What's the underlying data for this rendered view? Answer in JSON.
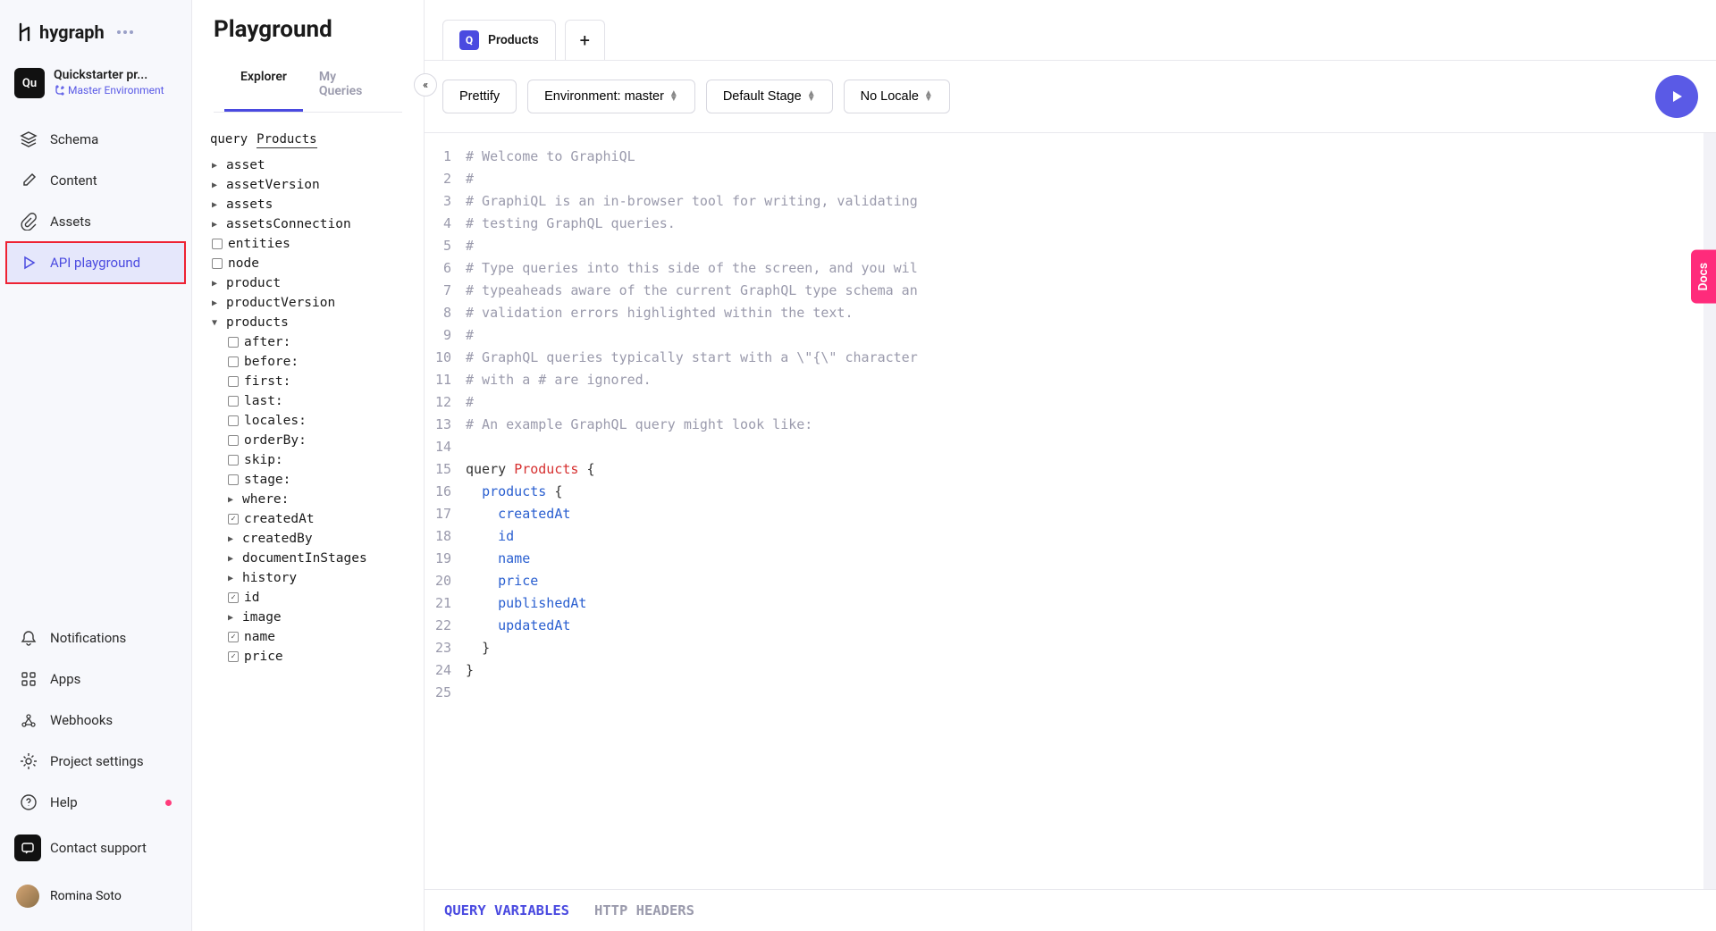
{
  "brand": {
    "name": "hygraph"
  },
  "project": {
    "badge": "Qu",
    "name": "Quickstarter pr...",
    "env_label": "Master Environment"
  },
  "sidebar": {
    "primary": [
      {
        "label": "Schema"
      },
      {
        "label": "Content"
      },
      {
        "label": "Assets"
      },
      {
        "label": "API playground"
      }
    ],
    "secondary": [
      {
        "label": "Notifications"
      },
      {
        "label": "Apps"
      },
      {
        "label": "Webhooks"
      },
      {
        "label": "Project settings"
      },
      {
        "label": "Help"
      },
      {
        "label": "Contact support"
      }
    ],
    "user": "Romina Soto"
  },
  "page": {
    "title": "Playground"
  },
  "explorer": {
    "tabs": [
      {
        "label": "Explorer"
      },
      {
        "label": "My Queries"
      }
    ],
    "query_kw": "query",
    "query_name": "Products",
    "tree": {
      "roots": [
        {
          "type": "arrow",
          "label": "asset"
        },
        {
          "type": "arrow",
          "label": "assetVersion"
        },
        {
          "type": "arrow",
          "label": "assets"
        },
        {
          "type": "arrow",
          "label": "assetsConnection"
        },
        {
          "type": "box",
          "label": "entities"
        },
        {
          "type": "box",
          "label": "node"
        },
        {
          "type": "arrow",
          "label": "product"
        },
        {
          "type": "arrow",
          "label": "productVersion"
        },
        {
          "type": "arrow-open",
          "label": "products"
        }
      ],
      "products_children": [
        {
          "type": "box",
          "label": "after:"
        },
        {
          "type": "box",
          "label": "before:"
        },
        {
          "type": "box",
          "label": "first:"
        },
        {
          "type": "box",
          "label": "last:"
        },
        {
          "type": "box",
          "label": "locales:"
        },
        {
          "type": "box",
          "label": "orderBy:"
        },
        {
          "type": "box",
          "label": "skip:"
        },
        {
          "type": "box",
          "label": "stage:"
        },
        {
          "type": "arrow",
          "label": "where:"
        },
        {
          "type": "checked",
          "label": "createdAt"
        },
        {
          "type": "arrow",
          "label": "createdBy"
        },
        {
          "type": "arrow",
          "label": "documentInStages"
        },
        {
          "type": "arrow",
          "label": "history"
        },
        {
          "type": "checked",
          "label": "id"
        },
        {
          "type": "arrow",
          "label": "image"
        },
        {
          "type": "checked",
          "label": "name"
        },
        {
          "type": "checked",
          "label": "price"
        }
      ]
    }
  },
  "queryTabs": {
    "active_label": "Products",
    "active_badge": "Q"
  },
  "toolbar": {
    "prettify": "Prettify",
    "env": "Environment: master",
    "stage": "Default Stage",
    "locale": "No Locale"
  },
  "code": {
    "lines": [
      {
        "n": 1,
        "t": "comment",
        "text": "# Welcome to GraphiQL"
      },
      {
        "n": 2,
        "t": "comment",
        "text": "#"
      },
      {
        "n": 3,
        "t": "comment",
        "text": "# GraphiQL is an in-browser tool for writing, validating"
      },
      {
        "n": 4,
        "t": "comment",
        "text": "# testing GraphQL queries."
      },
      {
        "n": 5,
        "t": "comment",
        "text": "#"
      },
      {
        "n": 6,
        "t": "comment",
        "text": "# Type queries into this side of the screen, and you wil"
      },
      {
        "n": 7,
        "t": "comment",
        "text": "# typeaheads aware of the current GraphQL type schema an"
      },
      {
        "n": 8,
        "t": "comment",
        "text": "# validation errors highlighted within the text."
      },
      {
        "n": 9,
        "t": "comment",
        "text": "#"
      },
      {
        "n": 10,
        "t": "comment",
        "text": "# GraphQL queries typically start with a \\\"{\\\" character"
      },
      {
        "n": 11,
        "t": "comment",
        "text": "# with a # are ignored."
      },
      {
        "n": 12,
        "t": "comment",
        "text": "#"
      },
      {
        "n": 13,
        "t": "comment",
        "text": "# An example GraphQL query might look like:"
      },
      {
        "n": 14,
        "t": "blank",
        "text": ""
      },
      {
        "n": 15,
        "t": "queryhdr",
        "kw": "query",
        "name": "Products",
        "brace": "{"
      },
      {
        "n": 16,
        "t": "open",
        "indent": 1,
        "field": "products",
        "brace": "{"
      },
      {
        "n": 17,
        "t": "field",
        "indent": 2,
        "field": "createdAt"
      },
      {
        "n": 18,
        "t": "field",
        "indent": 2,
        "field": "id"
      },
      {
        "n": 19,
        "t": "field",
        "indent": 2,
        "field": "name"
      },
      {
        "n": 20,
        "t": "field",
        "indent": 2,
        "field": "price"
      },
      {
        "n": 21,
        "t": "field",
        "indent": 2,
        "field": "publishedAt"
      },
      {
        "n": 22,
        "t": "field",
        "indent": 2,
        "field": "updatedAt"
      },
      {
        "n": 23,
        "t": "close",
        "indent": 1,
        "brace": "}"
      },
      {
        "n": 24,
        "t": "close",
        "indent": 0,
        "brace": "}"
      },
      {
        "n": 25,
        "t": "blank",
        "text": ""
      }
    ]
  },
  "bottomTabs": {
    "vars": "QUERY VARIABLES",
    "headers": "HTTP HEADERS"
  },
  "docsTab": "Docs"
}
